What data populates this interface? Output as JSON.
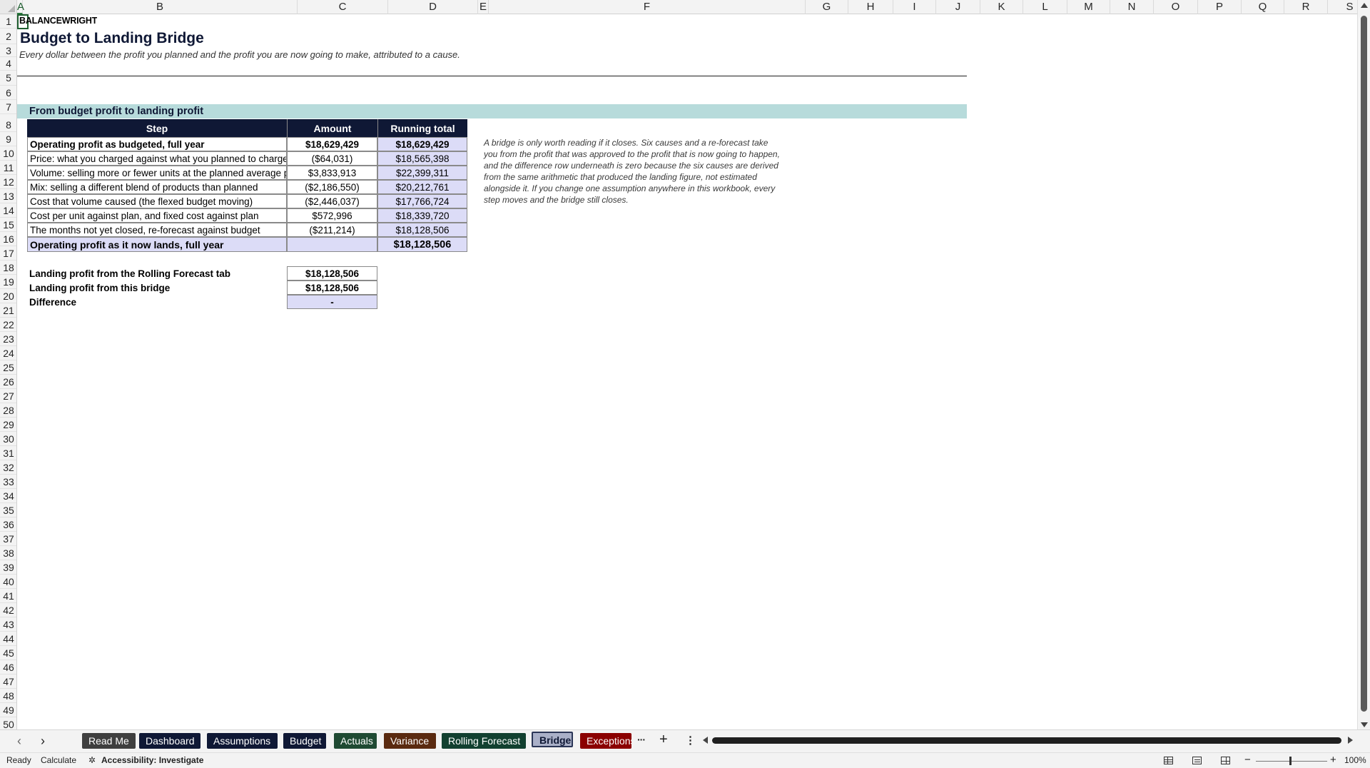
{
  "columns": [
    "A",
    "B",
    "C",
    "D",
    "E",
    "F",
    "G",
    "H",
    "I",
    "J",
    "K",
    "L",
    "M",
    "N",
    "O",
    "P",
    "Q",
    "R",
    "S"
  ],
  "rows": [
    "1",
    "2",
    "3",
    "4",
    "5",
    "6",
    "7",
    "8",
    "9",
    "10",
    "11",
    "12",
    "13",
    "14",
    "15",
    "16",
    "17",
    "18",
    "19",
    "20",
    "21",
    "22",
    "23",
    "24",
    "25",
    "26",
    "27",
    "28",
    "29",
    "30",
    "31",
    "32",
    "33",
    "34",
    "35",
    "36",
    "37",
    "38",
    "39",
    "40",
    "41",
    "42",
    "43",
    "44",
    "45",
    "46",
    "47",
    "48",
    "49",
    "50"
  ],
  "sheet": {
    "brand": "BALANCEWRIGHT",
    "title": "Budget to Landing Bridge",
    "subtitle": "Every dollar between the profit you planned and the profit you are now going to make, attributed to a cause.",
    "section_title": "From budget profit to landing profit",
    "table_headers": [
      "Step",
      "Amount",
      "Running total"
    ],
    "bridge_rows": [
      {
        "step": "Operating profit as budgeted, full year",
        "amount": "$18,629,429",
        "running": "$18,629,429"
      },
      {
        "step": "Price: what you charged against what you planned to charge",
        "amount": "($64,031)",
        "running": "$18,565,398"
      },
      {
        "step": "Volume: selling more or fewer units at the planned average pric",
        "amount": "$3,833,913",
        "running": "$22,399,311"
      },
      {
        "step": "Mix: selling a different blend of products than planned",
        "amount": "($2,186,550)",
        "running": "$20,212,761"
      },
      {
        "step": "Cost that volume caused (the flexed budget moving)",
        "amount": "($2,446,037)",
        "running": "$17,766,724"
      },
      {
        "step": "Cost per unit against plan, and fixed cost against plan",
        "amount": "$572,996",
        "running": "$18,339,720"
      },
      {
        "step": "The months not yet closed, re-forecast against budget",
        "amount": "($211,214)",
        "running": "$18,128,506"
      }
    ],
    "landing_row": {
      "step": "Operating profit as it now lands, full year",
      "amount": "",
      "running": "$18,128,506"
    },
    "check_rows": [
      {
        "label": "Landing profit from the Rolling Forecast tab",
        "value": "$18,128,506"
      },
      {
        "label": "Landing profit from this bridge",
        "value": "$18,128,506"
      },
      {
        "label": "Difference",
        "value": "-"
      }
    ],
    "note_lines": [
      "A bridge is only worth reading if it closes. Six causes and a re-forecast take",
      "you from the profit that was approved to the profit that is now going to happen,",
      "and the difference row underneath is zero because the six causes are derived",
      "from the same arithmetic that produced the landing figure, not estimated",
      "alongside it. If you change one assumption anywhere in this workbook, every",
      "step moves and the bridge still closes."
    ]
  },
  "tabs": [
    {
      "label": "Read Me",
      "color": "#3f3f3f",
      "active": false
    },
    {
      "label": "Dashboard",
      "color": "#0f1835",
      "active": false
    },
    {
      "label": "Assumptions",
      "color": "#0f1835",
      "active": false
    },
    {
      "label": "Budget",
      "color": "#0f1835",
      "active": false
    },
    {
      "label": "Actuals",
      "color": "#1f4a33",
      "active": false
    },
    {
      "label": "Variance",
      "color": "#5a2a10",
      "active": false
    },
    {
      "label": "Rolling Forecast",
      "color": "#124030",
      "active": false
    },
    {
      "label": "Bridge",
      "color": "#2a3556",
      "active": true
    },
    {
      "label": "Exceptions",
      "color": "#8b0000",
      "active": false
    }
  ],
  "status": {
    "ready": "Ready",
    "calculate": "Calculate",
    "accessibility": "Accessibility: Investigate",
    "zoom": "100%"
  },
  "icons": {
    "prev_sheet": "chevron-left",
    "next_sheet": "chevron-right",
    "more_sheets": "ellipsis",
    "add_sheet": "plus",
    "options": "vertical-ellipsis"
  },
  "colors": {
    "section_band": "#b7dbdb",
    "header_fill": "#0f1835",
    "total_fill": "#dcdcf7"
  }
}
